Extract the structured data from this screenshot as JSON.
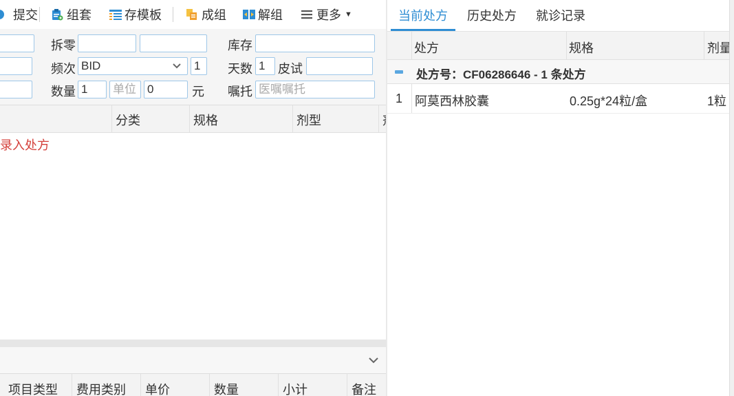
{
  "toolbar": {
    "submit_label": "提交",
    "set_label": "组套",
    "save_template_label": "存模板",
    "group_label": "成组",
    "ungroup_label": "解组",
    "more_label": "更多"
  },
  "form": {
    "split_label": "拆零",
    "stock_label": "库存",
    "frequency_label": "频次",
    "frequency_value": "BID",
    "frequency_times_value": "1",
    "days_label": "天数",
    "days_value": "1",
    "skin_test_label": "皮试",
    "quantity_label": "数量",
    "quantity_value": "1",
    "unit_placeholder": "单位",
    "amount_value": "0",
    "currency_unit": "元",
    "advice_label": "嘱托",
    "advice_placeholder": "医嘱嘱托"
  },
  "drug_grid": {
    "columns": [
      "分类",
      "规格",
      "剂型",
      "剂"
    ],
    "empty_message": "请录入处方"
  },
  "fee_grid": {
    "columns": [
      "项目类型",
      "费用类别",
      "单价",
      "数量",
      "小计",
      "备注"
    ]
  },
  "right": {
    "tabs": [
      "当前处方",
      "历史处方",
      "就诊记录"
    ],
    "columns": [
      "处方",
      "规格",
      "剂量"
    ],
    "group_title": "处方号：CF06286646 - 1 条处方",
    "rows": [
      {
        "index": "1",
        "name": "阿莫西林胶囊",
        "spec": "0.25g*24粒/盒",
        "dose": "1粒"
      }
    ]
  },
  "colors": {
    "accent": "#2e8dd3",
    "error": "#d43f3a",
    "input_border": "#9ec7e8"
  }
}
